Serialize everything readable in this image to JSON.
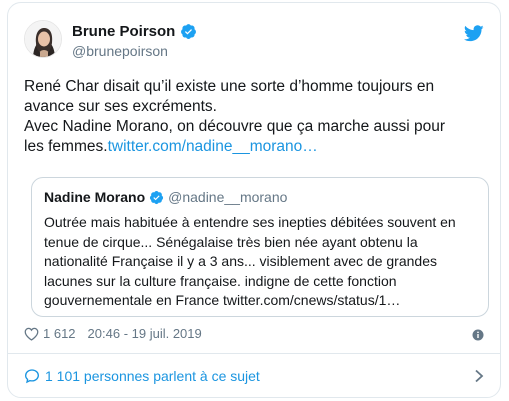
{
  "tweet": {
    "author_name": "Brune Poirson",
    "author_handle": "@brunepoirson",
    "text_lines": [
      "René Char disait qu’il existe une sorte d’homme toujours en",
      "avance sur ses excréments.",
      "Avec Nadine Morano, on découvre que ça marche aussi pour"
    ],
    "text_last_prefix": "les femmes.",
    "text_link": "twitter.com/nadine__morano…",
    "likes": "1 612",
    "timestamp": "20:46 - 19 juil. 2019",
    "footer_label": "1 101 personnes parlent à ce sujet"
  },
  "quoted": {
    "author_name": "Nadine Morano",
    "author_handle": "@nadine__morano",
    "text_lines": [
      "Outrée mais habituée à entendre ses inepties débitées souvent en",
      "tenue de cirque... Sénégalaise très bien née ayant obtenu la",
      "nationalité Française il y a 3 ans... visiblement avec de grandes",
      "lacunes sur la culture française. indigne de cette fonction",
      "gouvernementale en France twitter.com/cnews/status/1…"
    ]
  },
  "colors": {
    "accent": "#1b95e0",
    "muted": "#657786",
    "border": "#e1e8ed"
  },
  "icons": [
    "verified-icon",
    "twitter-bird-icon",
    "heart-icon",
    "info-icon",
    "comment-bubble-icon",
    "chevron-right-icon"
  ]
}
